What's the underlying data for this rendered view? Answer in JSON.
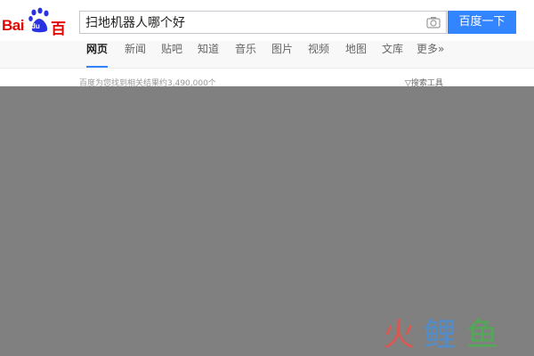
{
  "logo": {
    "latin": "Bai",
    "paw_text": "du",
    "chinese": "百度",
    "colors": {
      "red": "#e10601",
      "blue": "#2932e1"
    }
  },
  "search": {
    "query": "扫地机器人哪个好",
    "button_label": "百度一下",
    "camera_icon": "camera-icon",
    "accent": "#3385ff"
  },
  "nav": {
    "tabs": [
      {
        "label": "网页",
        "active": true
      },
      {
        "label": "新闻"
      },
      {
        "label": "贴吧"
      },
      {
        "label": "知道"
      },
      {
        "label": "音乐"
      },
      {
        "label": "图片"
      },
      {
        "label": "视频"
      },
      {
        "label": "地图"
      },
      {
        "label": "文库"
      },
      {
        "label": "更多»"
      }
    ]
  },
  "results": {
    "count_text": "百度为您找到相关结果约3,490,000个",
    "tools_label": "▽搜索工具"
  },
  "overlay": {
    "color": "#808080"
  },
  "watermark": {
    "text": "火鲤鱼",
    "colors": [
      "#e8534b",
      "#4a90d9",
      "#4caf50"
    ]
  }
}
